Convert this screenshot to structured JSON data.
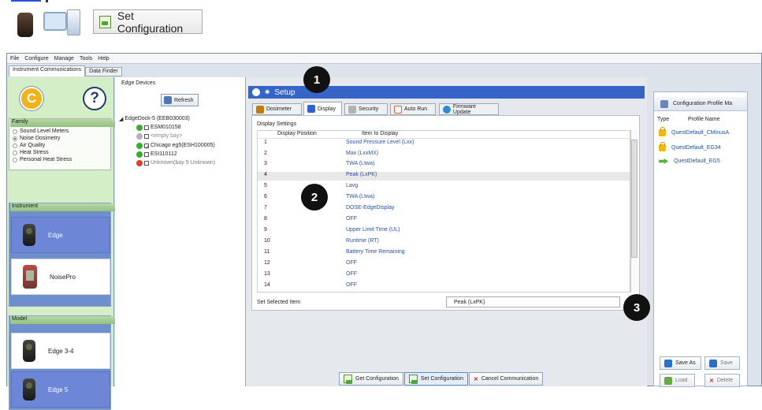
{
  "top": {
    "set_configuration": "Set Configuration"
  },
  "app": {
    "menu": [
      "File",
      "Configure",
      "Manage",
      "Tools",
      "Help"
    ],
    "tabs": [
      "Instrument Communications",
      "Data Finder"
    ],
    "left_panel": {
      "family_title": "Family",
      "family_options": [
        "Sound Level Meters",
        "Noise Dosimetry",
        "Air Quality",
        "Heat Stress",
        "Personal Heat Stress"
      ],
      "instrument_title": "Instrument",
      "instruments": [
        "Edge",
        "NoisePro"
      ],
      "model_title": "Model",
      "models": [
        "Edge 3-4",
        "Edge 5"
      ]
    },
    "edge_devices": {
      "title": "Edge Devices",
      "refresh": "Refresh",
      "dock": "EdgeDock-5 (EEB030003)",
      "items": [
        "ESM010158",
        "<empty bay>",
        "Chicago eg5(ESH100005)",
        "ESI110112",
        "Unknown(bay 5 Unknown)"
      ]
    },
    "setup": {
      "title": "Setup",
      "tabs": [
        "Dosimeter",
        "Display",
        "Security",
        "Auto Run",
        "Firmware Update"
      ],
      "display_settings": "Display Settings",
      "columns": [
        "Display Position",
        "Item to Display"
      ],
      "rows": [
        {
          "pos": "1",
          "item": "Sound Pressure Level (Lxx)"
        },
        {
          "pos": "2",
          "item": "Max (LxxMX)"
        },
        {
          "pos": "3",
          "item": "TWA (Ltwa)"
        },
        {
          "pos": "4",
          "item": "Peak (LxPK)"
        },
        {
          "pos": "5",
          "item": "Lavg"
        },
        {
          "pos": "6",
          "item": "TWA (Ltwa)"
        },
        {
          "pos": "7",
          "item": "DOSE-EdgeDisplay"
        },
        {
          "pos": "8",
          "item": "OFF"
        },
        {
          "pos": "9",
          "item": "Upper Limit Time (UL)"
        },
        {
          "pos": "10",
          "item": "Runtime (RT)"
        },
        {
          "pos": "11",
          "item": "Battery Time Remaining"
        },
        {
          "pos": "12",
          "item": "OFF"
        },
        {
          "pos": "13",
          "item": "OFF"
        },
        {
          "pos": "14",
          "item": "OFF"
        }
      ],
      "set_selected_item": "Set Selected Item",
      "selected_value": "Peak (LxPK)",
      "buttons": [
        "Get Configuration",
        "Set Configuration",
        "Cancel Communication"
      ]
    },
    "profiles": {
      "title": "Configuration Profile Ma",
      "columns": [
        "Type",
        "Profile Name"
      ],
      "items": [
        "QuestDefault_CMinusA",
        "QuestDefault_EG34",
        "QuestDefault_EG5"
      ],
      "buttons": [
        "Save As",
        "Save",
        "Load",
        "Delete"
      ]
    }
  },
  "callouts": [
    "1",
    "2",
    "3"
  ]
}
